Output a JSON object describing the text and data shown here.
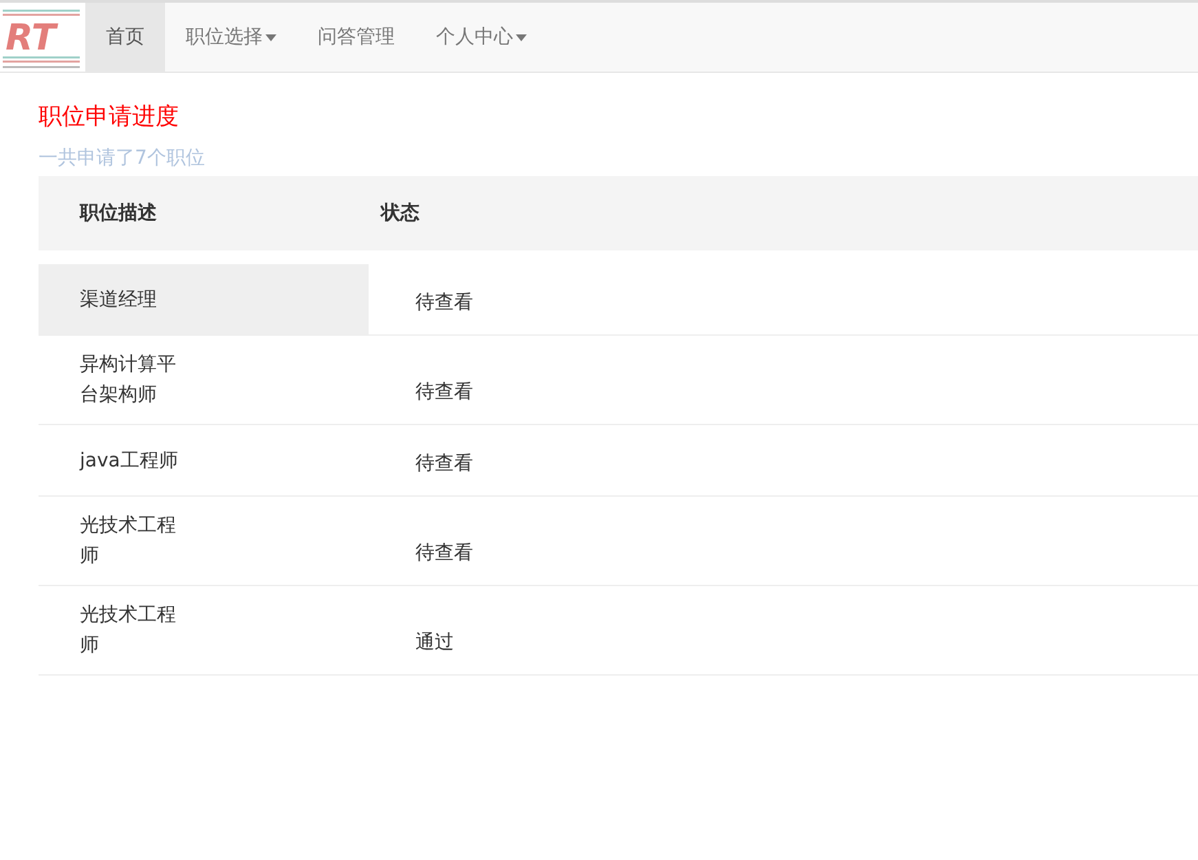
{
  "logo": {
    "mark": "RT"
  },
  "nav": [
    {
      "label": "首页",
      "selected": true,
      "dropdown": false
    },
    {
      "label": "职位选择",
      "selected": false,
      "dropdown": true
    },
    {
      "label": "问答管理",
      "selected": false,
      "dropdown": false
    },
    {
      "label": "个人中心",
      "selected": false,
      "dropdown": true
    }
  ],
  "title": "职位申请进度",
  "summary": "一共申请了7个职位",
  "table": {
    "columns": [
      "职位描述",
      "状态"
    ],
    "rows": [
      {
        "position": "渠道经理",
        "status": "待查看",
        "highlighted": true
      },
      {
        "position": "异构计算平台架构师",
        "status": "待查看",
        "highlighted": false
      },
      {
        "position": "java工程师",
        "status": "待查看",
        "highlighted": false
      },
      {
        "position": "光技术工程师",
        "status": "待查看",
        "highlighted": false
      },
      {
        "position": "光技术工程师",
        "status": "通过",
        "highlighted": false
      }
    ]
  }
}
